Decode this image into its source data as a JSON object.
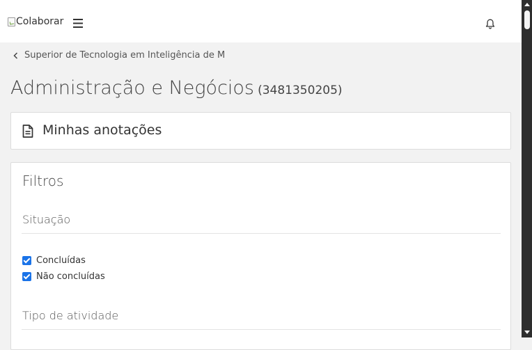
{
  "header": {
    "logo_alt": "Colaborar",
    "menu_icon": "hamburger-menu-icon",
    "notification_icon": "bell-icon"
  },
  "breadcrumb": {
    "back_icon": "chevron-left-icon",
    "label": "Superior de Tecnologia em Inteligência de M"
  },
  "page": {
    "title": "Administração e Negócios",
    "code": "(3481350205)"
  },
  "notes_card": {
    "icon": "document-icon",
    "title": "Minhas anotações"
  },
  "filters": {
    "title": "Filtros",
    "situacao": {
      "title": "Situação",
      "options": [
        {
          "label": "Concluídas",
          "checked": true
        },
        {
          "label": "Não concluídas",
          "checked": true
        }
      ]
    },
    "tipo": {
      "title": "Tipo de atividade"
    }
  },
  "colors": {
    "accent": "#1a73e8",
    "background": "#f2f2f2",
    "card": "#ffffff",
    "scrollbar": "#2e2e2e"
  }
}
